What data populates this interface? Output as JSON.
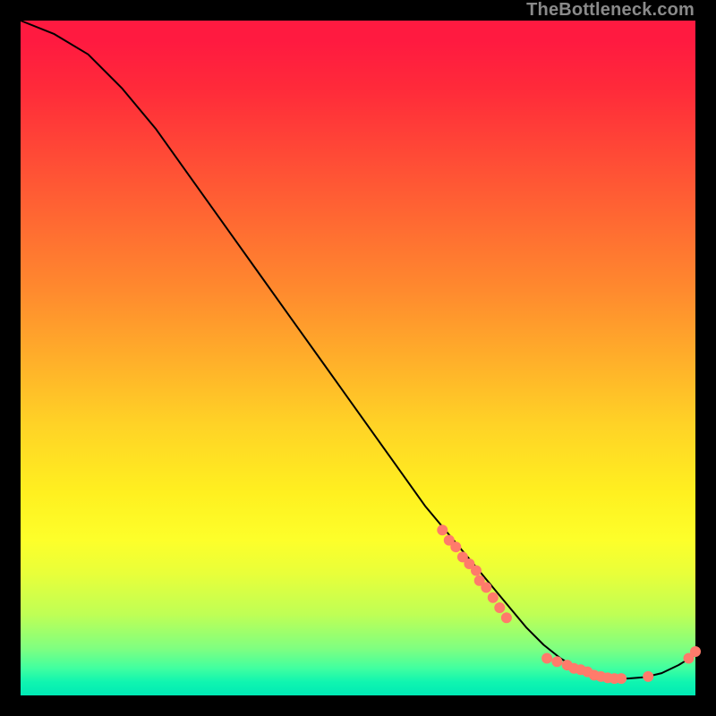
{
  "watermark": "TheBottleneck.com",
  "chart_data": {
    "type": "line",
    "title": "",
    "xlabel": "",
    "ylabel": "",
    "xlim": [
      0,
      100
    ],
    "ylim": [
      0,
      100
    ],
    "grid": false,
    "series": [
      {
        "name": "curve",
        "color": "#000000",
        "x": [
          0,
          5,
          10,
          15,
          20,
          25,
          30,
          35,
          40,
          45,
          50,
          55,
          60,
          62.5,
          65,
          67.5,
          70,
          72.5,
          75,
          77.5,
          80,
          82.5,
          85,
          87.5,
          90,
          92.5,
          95,
          97.5,
          100
        ],
        "y": [
          100,
          98,
          95,
          90,
          84,
          77,
          70,
          63,
          56,
          49,
          42,
          35,
          28,
          25,
          22,
          19,
          16,
          13,
          10,
          7.5,
          5.5,
          4,
          3,
          2.5,
          2.5,
          2.7,
          3.3,
          4.5,
          6
        ]
      }
    ],
    "markers": {
      "name": "gpu-points",
      "color": "#ff7b6b",
      "radius_px": 6,
      "points": [
        {
          "x": 62.5,
          "y": 24.5
        },
        {
          "x": 63.5,
          "y": 23.0
        },
        {
          "x": 64.5,
          "y": 22.0
        },
        {
          "x": 65.5,
          "y": 20.5
        },
        {
          "x": 66.5,
          "y": 19.5
        },
        {
          "x": 67.5,
          "y": 18.5
        },
        {
          "x": 68.0,
          "y": 17.0
        },
        {
          "x": 69.0,
          "y": 16.0
        },
        {
          "x": 70.0,
          "y": 14.5
        },
        {
          "x": 71.0,
          "y": 13.0
        },
        {
          "x": 72.0,
          "y": 11.5
        },
        {
          "x": 78.0,
          "y": 5.5
        },
        {
          "x": 79.5,
          "y": 5.0
        },
        {
          "x": 81.0,
          "y": 4.5
        },
        {
          "x": 82.0,
          "y": 4.0
        },
        {
          "x": 83.0,
          "y": 3.8
        },
        {
          "x": 84.0,
          "y": 3.5
        },
        {
          "x": 85.0,
          "y": 3.0
        },
        {
          "x": 86.0,
          "y": 2.8
        },
        {
          "x": 87.0,
          "y": 2.6
        },
        {
          "x": 88.0,
          "y": 2.5
        },
        {
          "x": 89.0,
          "y": 2.5
        },
        {
          "x": 93.0,
          "y": 2.8
        },
        {
          "x": 99.0,
          "y": 5.5
        },
        {
          "x": 100.0,
          "y": 6.5
        }
      ]
    }
  }
}
